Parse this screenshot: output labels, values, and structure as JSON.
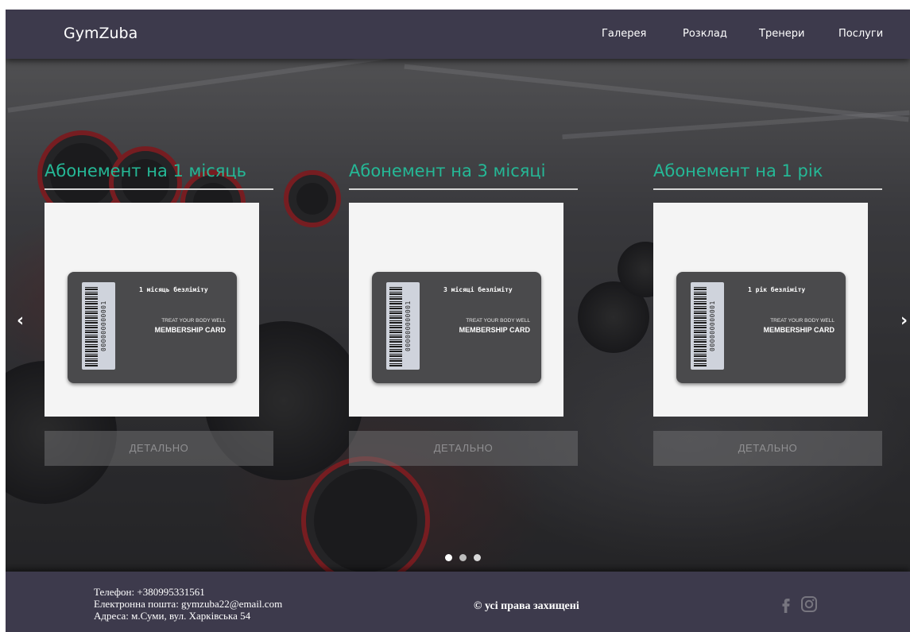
{
  "header": {
    "logo": "GymZuba",
    "nav": [
      "Галерея",
      "Розклад",
      "Тренери",
      "Послуги"
    ]
  },
  "carousel": {
    "prev_icon": "chevron-left-icon",
    "next_icon": "chevron-right-icon",
    "prev_glyph": "‹",
    "next_glyph": "›",
    "dots_count": 3,
    "active_dot": 1,
    "plans": [
      {
        "title": "Абонемент на 1 місяць",
        "card_title": "1 місяць безліміту",
        "card_number": "000000000001",
        "card_slogan": "TREAT YOUR BODY WELL",
        "card_label": "MEMBERSHIP CARD",
        "button": "ДЕТАЛЬНО"
      },
      {
        "title": "Абонемент на 3 місяці",
        "card_title": "3 місяці безліміту",
        "card_number": "000000000001",
        "card_slogan": "TREAT YOUR BODY WELL",
        "card_label": "MEMBERSHIP CARD",
        "button": "ДЕТАЛЬНО"
      },
      {
        "title": "Абонемент на 1 рік",
        "card_title": "1 рік безліміту",
        "card_number": "000000000001",
        "card_slogan": "TREAT YOUR BODY WELL",
        "card_label": "MEMBERSHIP CARD",
        "button": "ДЕТАЛЬНО"
      }
    ]
  },
  "footer": {
    "phone": "Телефон: +380995331561",
    "email": "Електронна пошта: gymzuba22@email.com",
    "address": "Адреса: м.Суми, вул. Харківська 54",
    "copyright": "© усі права захищені",
    "social": [
      "facebook-icon",
      "instagram-icon"
    ]
  },
  "colors": {
    "header_bg": "#3d3a4c",
    "accent": "#25b896",
    "button_bg": "#6e6e70"
  }
}
